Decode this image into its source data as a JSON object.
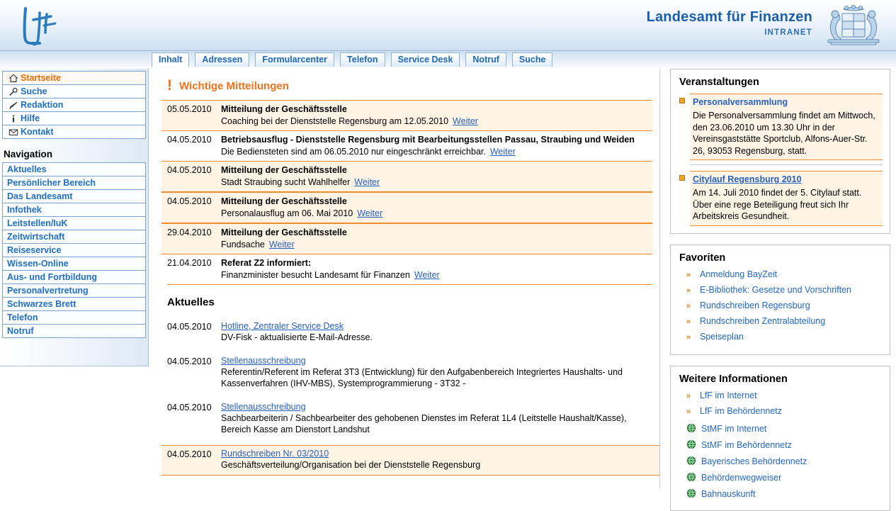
{
  "header": {
    "logo_alt": "LfF",
    "title": "Landesamt für Finanzen",
    "subtitle": "INTRANET",
    "coat_of_arms_alt": "Bayerisches Staatswappen"
  },
  "tabs": [
    {
      "label": "Inhalt",
      "active": true
    },
    {
      "label": "Adressen",
      "active": false
    },
    {
      "label": "Formularcenter",
      "active": false
    },
    {
      "label": "Telefon",
      "active": false
    },
    {
      "label": "Service Desk",
      "active": false
    },
    {
      "label": "Notruf",
      "active": false
    },
    {
      "label": "Suche",
      "active": false
    }
  ],
  "sidebar": {
    "quicklinks": [
      {
        "label": "Startseite",
        "icon": "home-icon",
        "active": true
      },
      {
        "label": "Suche",
        "icon": "search-icon",
        "active": false
      },
      {
        "label": "Redaktion",
        "icon": "pencil-icon",
        "active": false
      },
      {
        "label": "Hilfe",
        "icon": "info-icon",
        "active": false
      },
      {
        "label": "Kontakt",
        "icon": "envelope-icon",
        "active": false
      }
    ],
    "nav_heading": "Navigation",
    "nav_items": [
      {
        "label": "Aktuelles"
      },
      {
        "label": "Persönlicher Bereich"
      },
      {
        "label": "Das Landesamt"
      },
      {
        "label": "Infothek"
      },
      {
        "label": "Leitstellen/IuK"
      },
      {
        "label": "Zeitwirtschaft"
      },
      {
        "label": "Reiseservice"
      },
      {
        "label": "Wissen-Online"
      },
      {
        "label": "Aus- und Fortbildung"
      },
      {
        "label": "Personalvertretung"
      },
      {
        "label": "Schwarzes Brett"
      },
      {
        "label": "Telefon"
      },
      {
        "label": "Notruf"
      }
    ]
  },
  "content": {
    "wichtige_title": "Wichtige Mitteilungen",
    "wichtige_icon": "!",
    "messages": [
      {
        "date": "05.05.2010",
        "headline": "Mitteilung der Geschäftsstelle",
        "text": "Coaching bei der Dienststelle Regensburg am 12.05.2010",
        "more": "Weiter",
        "highlight": true
      },
      {
        "date": "04.05.2010",
        "headline": "Betriebsausflug - Dienststelle Regensburg mit Bearbeitungsstellen Passau, Straubing und Weiden",
        "text": "Die Bediensteten sind am 06.05.2010 nur eingeschränkt erreichbar.",
        "more": "Weiter",
        "highlight": false
      },
      {
        "date": "04.05.2010",
        "headline": "Mitteilung der Geschäftsstelle",
        "text": "Stadt Straubing sucht Wahlhelfer",
        "more": "Weiter",
        "highlight": true
      },
      {
        "date": "04.05.2010",
        "headline": "Mitteilung der Geschäftsstelle",
        "text": "Personalausflug am 06. Mai 2010",
        "more": "Weiter",
        "highlight": true
      },
      {
        "date": "29.04.2010",
        "headline": "Mitteilung der Geschäftsstelle",
        "text": "Fundsache",
        "more": "Weiter",
        "highlight": true
      },
      {
        "date": "21.04.2010",
        "headline": "Referat Z2 informiert:",
        "text": "Finanzminister besucht Landesamt für Finanzen",
        "more": "Weiter",
        "highlight": false
      }
    ],
    "aktuelles_title": "Aktuelles",
    "aktuelles": [
      {
        "date": "04.05.2010",
        "link": "Hotline, Zentraler Service Desk",
        "text": "DV-Fisk - aktualisierte E-Mail-Adresse.",
        "highlight": false
      },
      {
        "date": "04.05.2010",
        "link": "Stellenausschreibung",
        "text": "Referentin/Referent im Referat 3T3 (Entwicklung) für den Aufgabenbereich Integriertes Haushalts- und Kassenverfahren (IHV-MBS), Systemprogrammierung - 3T32 -",
        "highlight": false
      },
      {
        "date": "04.05.2010",
        "link": "Stellenausschreibung",
        "text": "Sachbearbeiterin / Sachbearbeiter des gehobenen Dienstes im Referat 1L4 (Leitstelle Haushalt/Kasse), Bereich Kasse am Dienstort Landshut",
        "highlight": false
      },
      {
        "date": "04.05.2010",
        "link": "Rundschreiben Nr. 03/2010",
        "text": "Geschäftsverteilung/Organisation bei der Dienststelle Regensburg",
        "highlight": true
      }
    ]
  },
  "rightbar": {
    "veranstaltungen": {
      "title": "Veranstaltungen",
      "items": [
        {
          "link": "Personalversammlung",
          "text": "Die Personalversammlung findet am Mittwoch, den 23.06.2010 um 13.30 Uhr in der Vereinsgaststätte Sportclub, Alfons-Auer-Str. 26, 93053 Regensburg, statt."
        },
        {
          "link": "Citylauf Regensburg 2010",
          "text": "Am 14. Juli 2010 findet der 5. Citylauf statt. Über eine rege Beteiligung freut sich Ihr Arbeitskreis Gesundheit."
        }
      ]
    },
    "favoriten": {
      "title": "Favoriten",
      "items": [
        {
          "label": "Anmeldung BayZeit",
          "icon": "double-arrow-icon"
        },
        {
          "label": "E-Bibliothek: Gesetze und Vorschriften",
          "icon": "double-arrow-icon"
        },
        {
          "label": "Rundschreiben Regensburg",
          "icon": "double-arrow-icon"
        },
        {
          "label": "Rundschreiben Zentralabteilung",
          "icon": "double-arrow-icon"
        },
        {
          "label": "Speiseplan",
          "icon": "double-arrow-icon"
        }
      ]
    },
    "weitere": {
      "title": "Weitere Informationen",
      "items": [
        {
          "label": "LfF im Internet",
          "icon": "double-arrow-icon"
        },
        {
          "label": "LfF im Behördennetz",
          "icon": "double-arrow-icon"
        },
        {
          "label": "StMF im Internet",
          "icon": "globe-icon"
        },
        {
          "label": "StMF im Behördennetz",
          "icon": "globe-icon"
        },
        {
          "label": "Bayerisches Behördennetz",
          "icon": "globe-icon"
        },
        {
          "label": "Behördenwegweiser",
          "icon": "globe-icon"
        },
        {
          "label": "Bahnauskunft",
          "icon": "globe-icon"
        }
      ]
    }
  },
  "colors": {
    "brand_blue": "#1c5fa8",
    "link_blue": "#2268c4",
    "accent_orange": "#f0721a",
    "highlight_bg": "#fdf4e6",
    "border_blue": "#7ba3cc"
  }
}
